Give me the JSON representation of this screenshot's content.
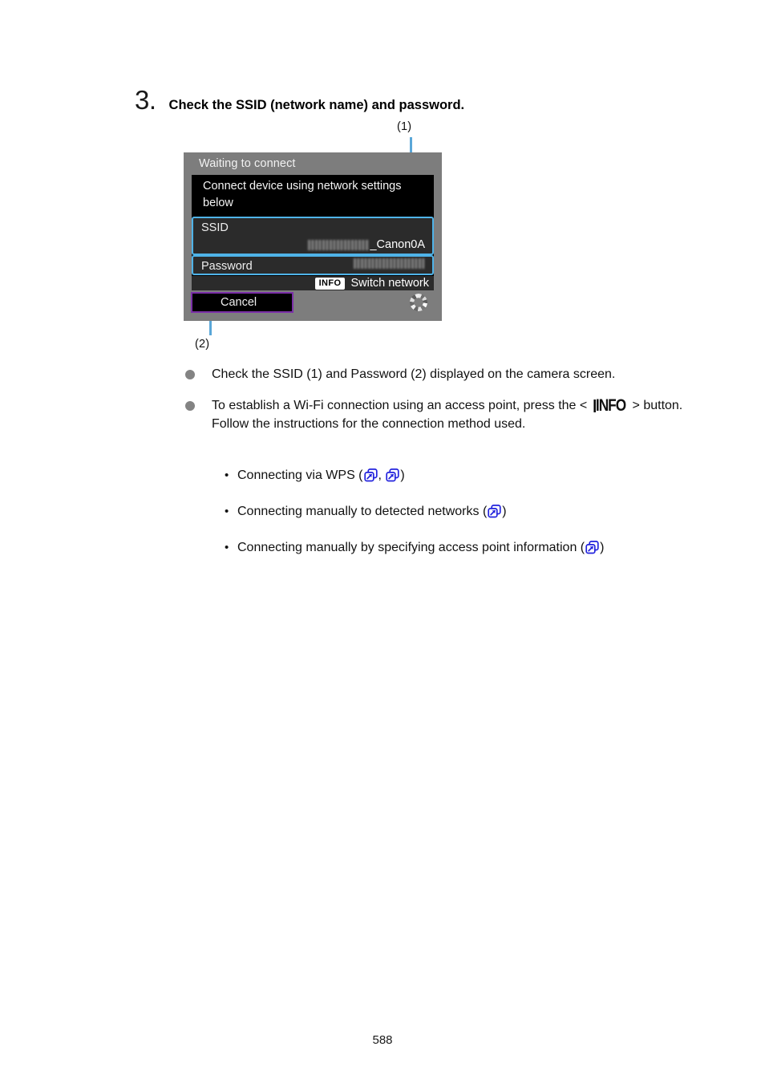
{
  "page": {
    "number": "588"
  },
  "step": {
    "number": "3.",
    "title": "Check the SSID (network name) and password."
  },
  "callouts": {
    "one": "(1)",
    "two": "(2)"
  },
  "camera_screen": {
    "title": "Waiting to connect",
    "instruction": "Connect device using network settings below",
    "ssid": {
      "label": "SSID",
      "value_masked": true,
      "value_suffix": "_Canon0A"
    },
    "password": {
      "label": "Password",
      "value_masked": true,
      "value_suffix": ""
    },
    "switch_network": {
      "badge": "INFO",
      "label": "Switch network"
    },
    "cancel_label": "Cancel",
    "spinner_name": "loading-spinner",
    "colors": {
      "highlight_border": "#4fb3e8",
      "cancel_border": "#7b2fa8",
      "screen_background": "#7d7d7d",
      "panel_background": "#000000"
    }
  },
  "bullets": [
    {
      "text": "Check the SSID (1) and Password (2) displayed on the camera screen."
    },
    {
      "text_before": "To establish a Wi-Fi connection using an access point, press the <",
      "glyph": "INFO",
      "text_after": "> button. Follow the instructions for the connection method used."
    }
  ],
  "sub_bullets": [
    {
      "text": "Connecting via WPS (",
      "separator": ",",
      "close": ")",
      "link_count": 2
    },
    {
      "text": "Connecting manually to detected networks (",
      "separator": "",
      "close": ")",
      "link_count": 1
    },
    {
      "text": "Connecting manually by specifying access point information (",
      "separator": "",
      "close": ")",
      "link_count": 1
    }
  ],
  "link_icon_color": "#2222dd"
}
